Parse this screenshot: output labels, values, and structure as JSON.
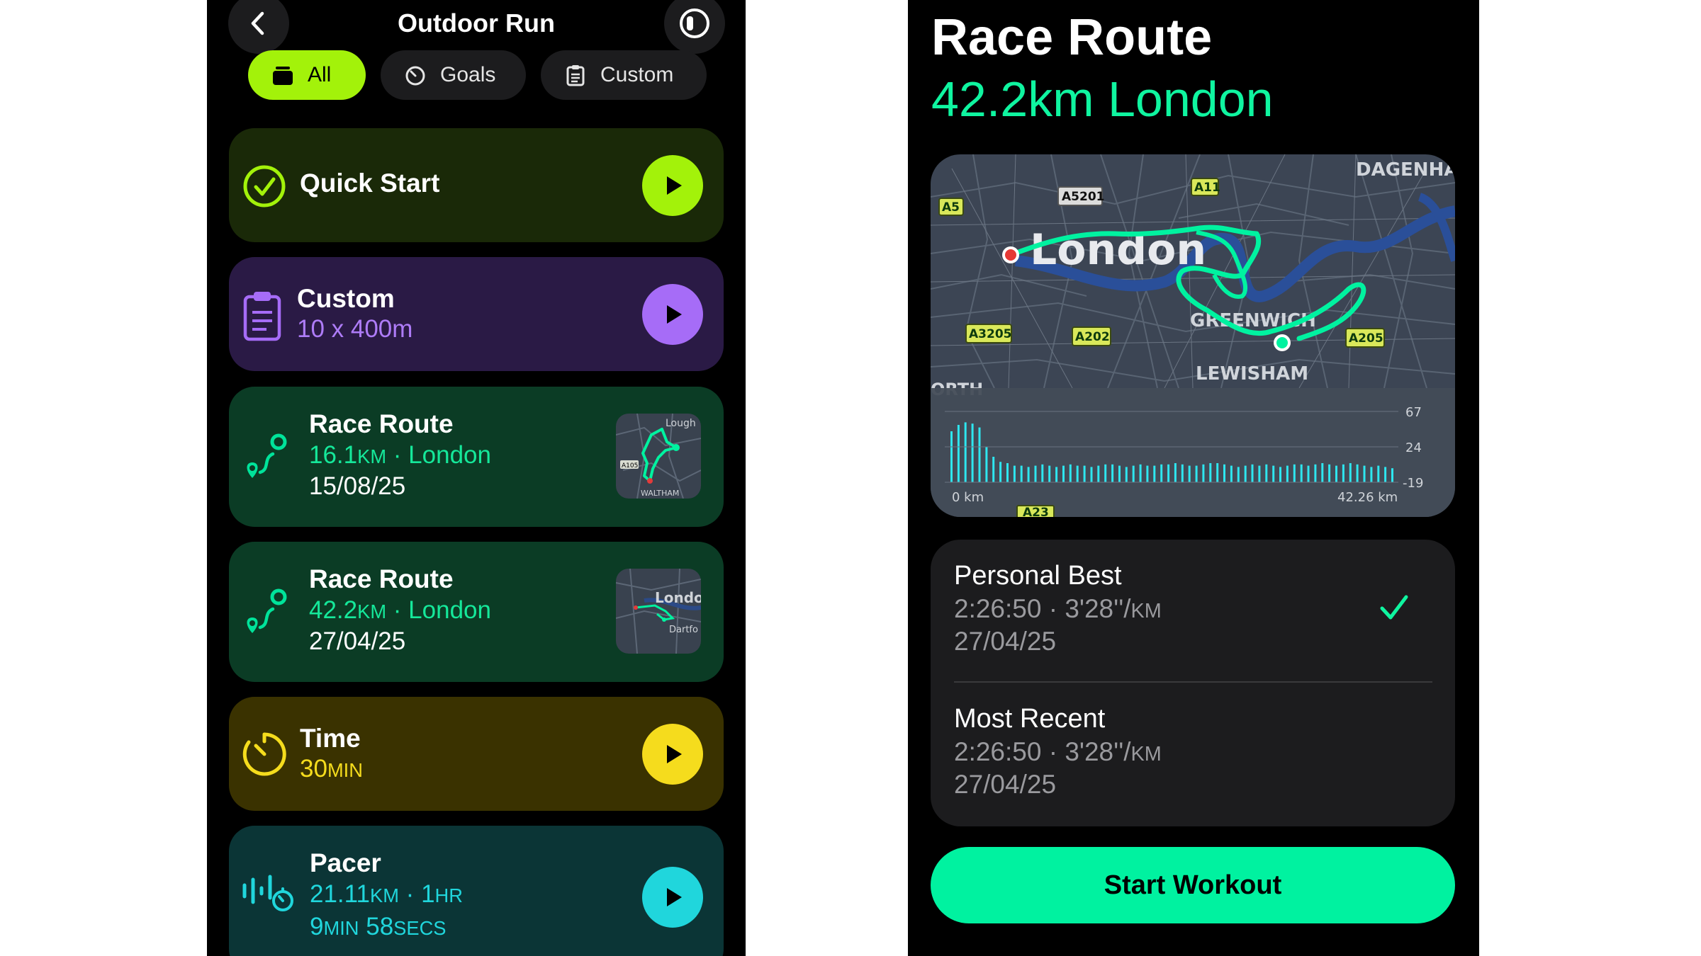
{
  "left": {
    "header": {
      "title": "Outdoor Run"
    },
    "filters": [
      {
        "label": "All"
      },
      {
        "label": "Goals"
      },
      {
        "label": "Custom"
      }
    ],
    "quick_start": {
      "title": "Quick Start"
    },
    "custom": {
      "title": "Custom",
      "subtitle": "10 x 400m"
    },
    "race1": {
      "title": "Race Route",
      "dist_num": "16.1",
      "dist_unit": "KM",
      "place": " · London",
      "date": "15/08/25",
      "thumb_top": "Lough",
      "thumb_bottom": "WALTHAM",
      "thumb_road": "A105"
    },
    "race2": {
      "title": "Race Route",
      "dist_num": "42.2",
      "dist_unit": "KM",
      "place": " · London",
      "date": "27/04/25",
      "thumb_city": "Londo",
      "thumb_town": "Dartfo"
    },
    "time": {
      "title": "Time",
      "num": "30",
      "unit": "MIN"
    },
    "pacer": {
      "title": "Pacer",
      "num1": "21.11",
      "unit1": "KM",
      "sep": " · ",
      "num2": "1",
      "unit2": "HR",
      "num3": "9",
      "unit3": "MIN",
      "num4": " 58",
      "unit4": "SECS"
    }
  },
  "right": {
    "title": "Race Route",
    "subtitle": "42.2km London",
    "map": {
      "labels": {
        "city": "London",
        "greenwich": "GREENWICH",
        "lewisham": "LEWISHAM",
        "dagenham": "DAGENHAM",
        "north": "ORTH"
      },
      "roads": [
        "A5",
        "A5201",
        "A11",
        "A3205",
        "A202",
        "A205",
        "A23"
      ]
    },
    "chart_data": {
      "type": "bar",
      "x_start_label": "0 km",
      "x_end_label": "42.26 km",
      "y_ticks": [
        "67",
        "24",
        "-19"
      ],
      "values": [
        40,
        45,
        47,
        46,
        43,
        28,
        20,
        16,
        15,
        13,
        13,
        12,
        13,
        14,
        13,
        12,
        13,
        14,
        13,
        13,
        12,
        13,
        14,
        14,
        13,
        12,
        13,
        14,
        13,
        13,
        14,
        14,
        15,
        14,
        13,
        13,
        14,
        15,
        15,
        14,
        13,
        12,
        13,
        14,
        13,
        14,
        13,
        12,
        13,
        14,
        14,
        13,
        14,
        15,
        14,
        13,
        14,
        15,
        14,
        13,
        12,
        13,
        12,
        11
      ],
      "ylim": [
        -19,
        67
      ]
    },
    "personal_best": {
      "title": "Personal Best",
      "time": "2:26:50 · 3'28''/",
      "unit": "KM",
      "date": "27/04/25"
    },
    "most_recent": {
      "title": "Most Recent",
      "time": "2:26:50 · 3'28''/",
      "unit": "KM",
      "date": "27/04/25"
    },
    "button": "Start Workout"
  }
}
